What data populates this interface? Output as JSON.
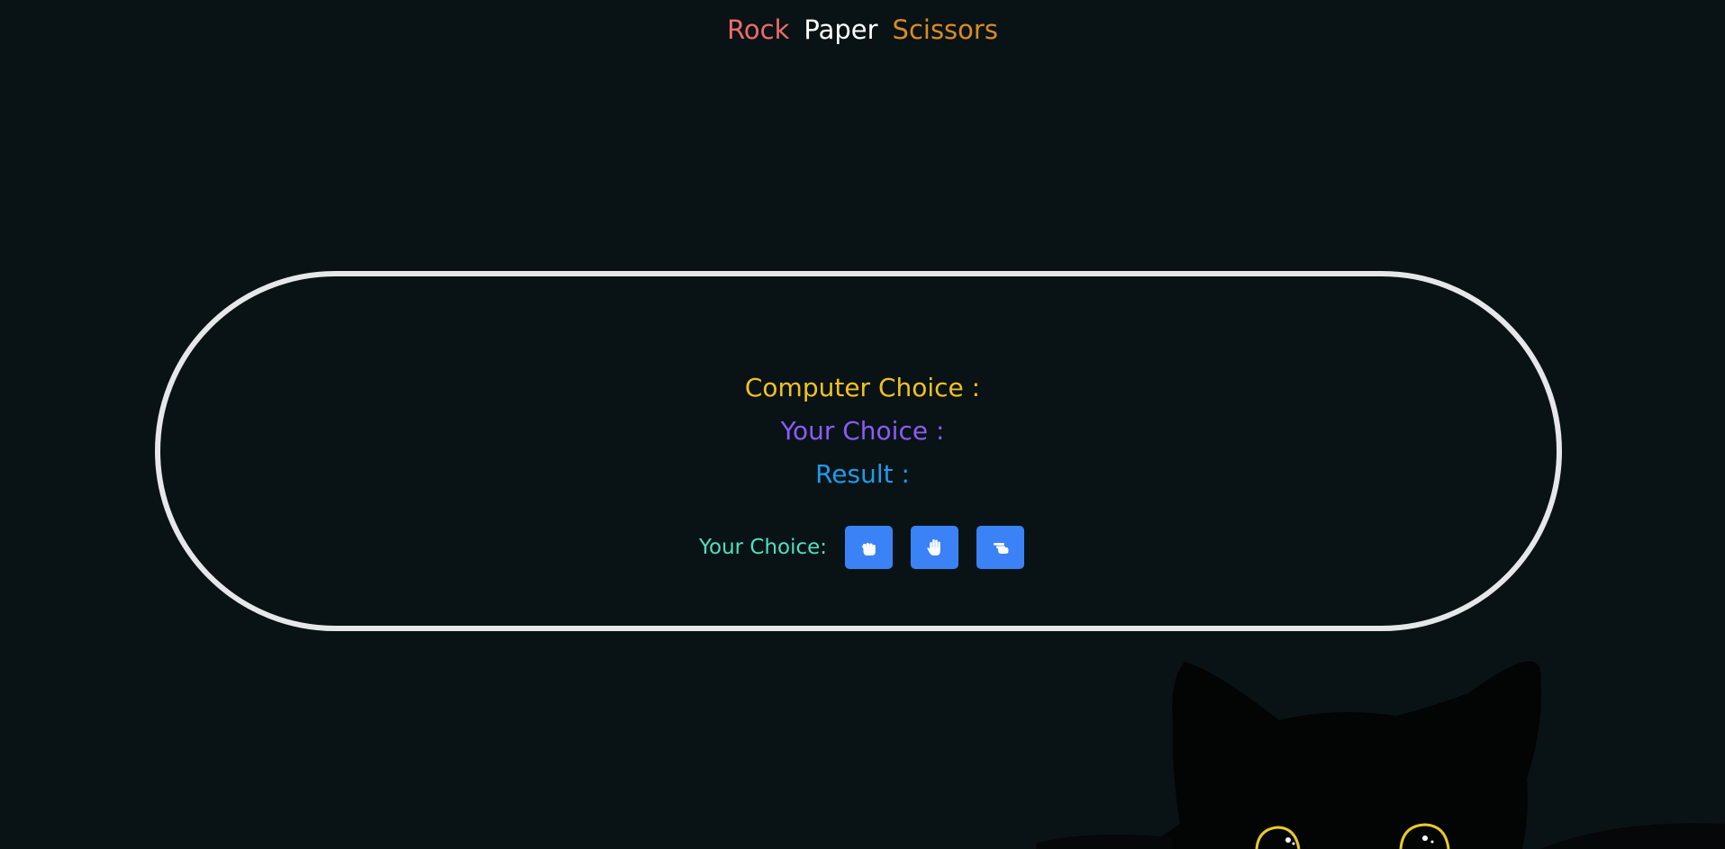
{
  "header": {
    "word_rock": "Rock",
    "word_paper": "Paper",
    "word_scissors": "Scissors"
  },
  "results": {
    "computer_choice": "Computer Choice :",
    "your_choice": "Your Choice :",
    "result": "Result :"
  },
  "controls": {
    "label": "Your Choice:",
    "buttons": [
      {
        "icon": "hand-rock-icon"
      },
      {
        "icon": "hand-paper-icon"
      },
      {
        "icon": "hand-scissors-icon"
      }
    ]
  },
  "colors": {
    "background": "#091315",
    "rock": "#ef6b6b",
    "paper": "#ffffff",
    "scissors": "#d98b24",
    "computer_choice": "#f2c122",
    "your_choice": "#8b5cf6",
    "result": "#1e9be9",
    "controls_label": "#4ee0c0",
    "button": "#3b82f6",
    "panel_border": "#e5e7eb"
  }
}
